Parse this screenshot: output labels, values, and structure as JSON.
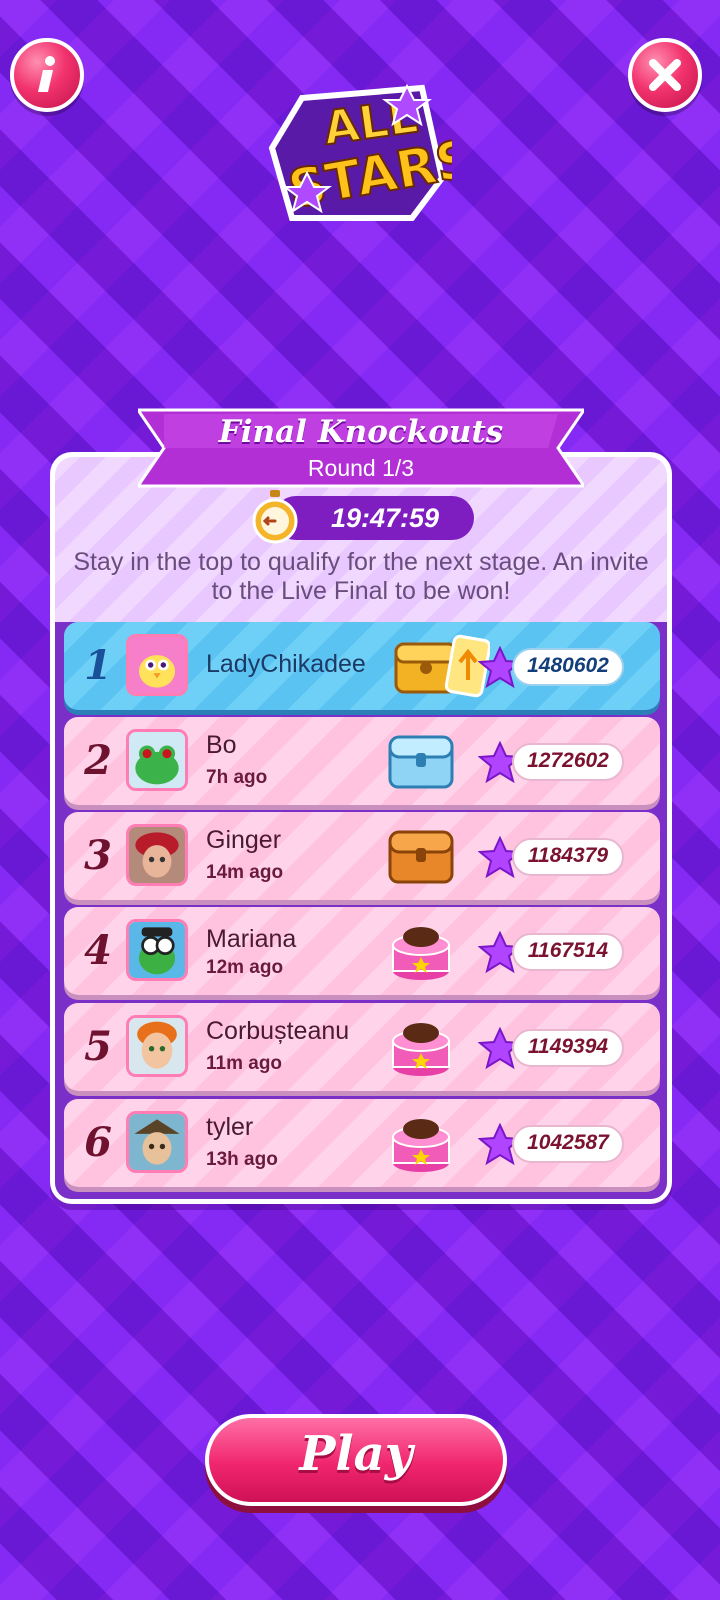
{
  "header": {
    "info_icon": "info-icon",
    "close_icon": "close-icon",
    "logo_text": "ALL STARS"
  },
  "panel": {
    "title": "Final Knockouts",
    "subtitle": "Round 1/3",
    "timer": "19:47:59",
    "description": "Stay in the top to qualify for the next stage. An invite to the Live Final to be won!"
  },
  "leaderboard": [
    {
      "rank": "1",
      "name": "LadyChikadee",
      "time": "",
      "score": "1480602",
      "prize": "gold-chest-ticket"
    },
    {
      "rank": "2",
      "name": "Bo",
      "time": "7h ago",
      "score": "1272602",
      "prize": "blue-chest"
    },
    {
      "rank": "3",
      "name": "Ginger",
      "time": "14m ago",
      "score": "1184379",
      "prize": "orange-chest"
    },
    {
      "rank": "4",
      "name": "Mariana",
      "time": "12m ago",
      "score": "1167514",
      "prize": "cake"
    },
    {
      "rank": "5",
      "name": "Corbușteanu",
      "time": "11m ago",
      "score": "1149394",
      "prize": "cake"
    },
    {
      "rank": "6",
      "name": "tyler",
      "time": "13h ago",
      "score": "1042587",
      "prize": "cake"
    }
  ],
  "footer": {
    "play_label": "Play"
  },
  "colors": {
    "background": "#7a1fe6",
    "accent_pink": "#f0266d",
    "first_row": "#5ac3f1",
    "row": "#ffc3e0"
  }
}
